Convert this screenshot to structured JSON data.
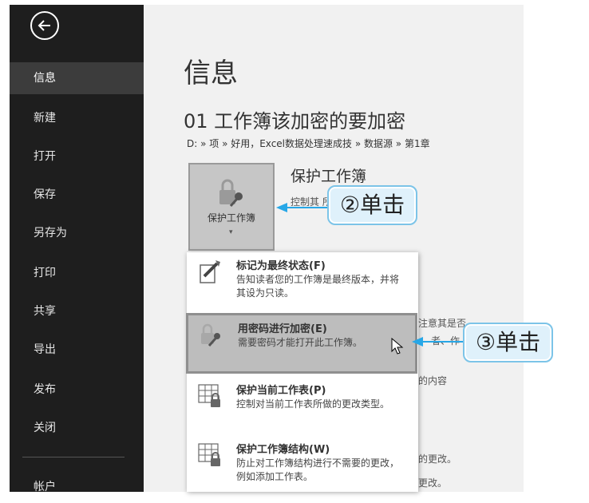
{
  "sidebar": {
    "back_icon": "arrow-left-icon",
    "items": [
      {
        "label": "信息"
      },
      {
        "label": "新建"
      },
      {
        "label": "打开"
      },
      {
        "label": "保存"
      },
      {
        "label": "另存为"
      },
      {
        "label": "打印"
      },
      {
        "label": "共享"
      },
      {
        "label": "导出"
      },
      {
        "label": "发布"
      },
      {
        "label": "关闭"
      },
      {
        "label": "帐户"
      }
    ],
    "colors": {
      "background": "#1e1e1e",
      "selected": "#3c3c3c"
    }
  },
  "main": {
    "page_title": "信息",
    "doc_title": "01 工作簿该加密的要加密",
    "doc_path": "D: » 项 » 好用，Excel数据处理速成技 » 数据源 » 第1章",
    "protect": {
      "button_label": "保护工作簿",
      "caret": "▾",
      "title": "保护工作簿",
      "description": "控制其 所做的更改类型。"
    },
    "bg_fragments": {
      "notice": "注意其是否",
      "notice_line2": "者、作",
      "content": "的内容",
      "changes1": "的更改。",
      "changes2": "更改。"
    }
  },
  "menu": {
    "items": [
      {
        "icon": "mark-final-icon",
        "title": "标记为最终状态(F)",
        "desc": "告知读者您的工作簿是最终版本，并将其设为只读。"
      },
      {
        "icon": "key-lock-icon",
        "title": "用密码进行加密(E)",
        "desc": "需要密码才能打开此工作簿。"
      },
      {
        "icon": "sheet-lock-icon",
        "title": "保护当前工作表(P)",
        "desc": "控制对当前工作表所做的更改类型。"
      },
      {
        "icon": "workbook-structure-lock-icon",
        "title": "保护工作簿结构(W)",
        "desc": "防止对工作簿结构进行不需要的更改，例如添加工作表。"
      }
    ]
  },
  "annotations": {
    "step2": "②单击",
    "step3": "③单击",
    "color": "#27a7e7"
  }
}
